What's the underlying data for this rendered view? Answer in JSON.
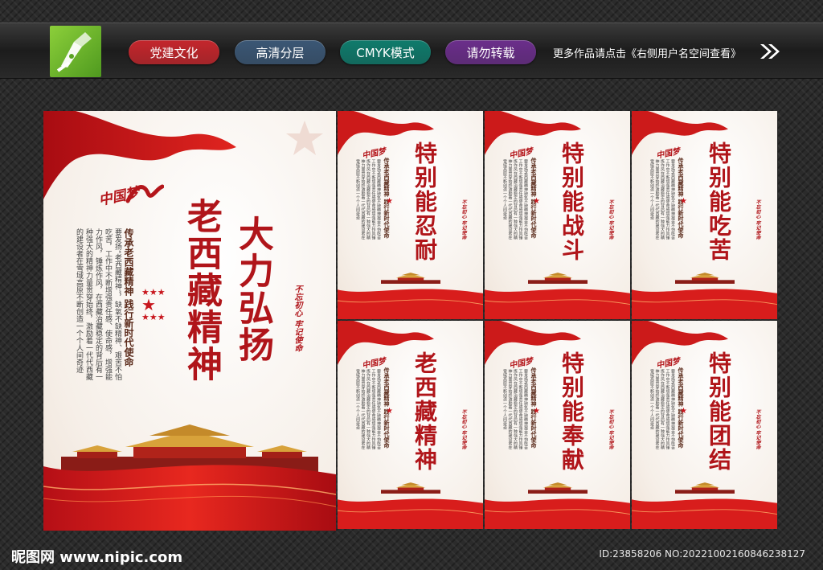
{
  "top_bar": {
    "tags": [
      {
        "label": "党建文化",
        "color": "#c4262c"
      },
      {
        "label": "高清分层",
        "color": "#3b5775"
      },
      {
        "label": "CMYK模式",
        "color": "#0f7b6c"
      },
      {
        "label": "请勿转载",
        "color": "#6b2e8b"
      }
    ],
    "more_text": "更多作品请点击《右侧用户名空间查看》",
    "logo_icon": "pen-nib-icon",
    "arrow_icon": "double-chevron-right-icon"
  },
  "main_poster": {
    "dream_logo": "中国梦",
    "headline_1": "大力弘扬",
    "headline_2": "老西藏精神",
    "subtitle": "传承老西藏精神  践行新时代使命",
    "body": "要发扬“老西藏精神”，缺氧不缺精神、艰苦不怕吃苦，工作中不断增强责任感、使命感，增强能力作风，锤炼作风，在西藏治藏稳定的背后有一种强大的精神力量贯穿始终，激励着一代代西藏的建设者在雪域高原不断创造一个个人间奇迹",
    "stamp": "不忘初心  牢记使命"
  },
  "small_posters": [
    {
      "title": "特别能忍耐"
    },
    {
      "title": "特别能战斗"
    },
    {
      "title": "特别能吃苦"
    },
    {
      "title": "老西藏精神"
    },
    {
      "title": "特别能奉献"
    },
    {
      "title": "特别能团结"
    }
  ],
  "small_common": {
    "dream_logo": "中国梦",
    "subtitle": "传承老西藏精神  践行新时代使命",
    "body": "要发扬老西藏精神缺氧不缺精神艰苦不怕吃苦工作中不断增强责任感使命感增强能力作风锤炼作风在西藏治藏稳定的背后有一种强大的精神力量贯穿始终激励着一代代西藏的建设者在雪域高原不断创造一个个人间奇迹",
    "stamp": "不忘初心  牢记使命"
  },
  "footer": {
    "site": "昵图网 www.nipic.com",
    "id_text": "ID:23858206 NO:20221002160846238127"
  },
  "colors": {
    "accent_red": "#b0151a",
    "ribbon_red": "#d4171d"
  }
}
